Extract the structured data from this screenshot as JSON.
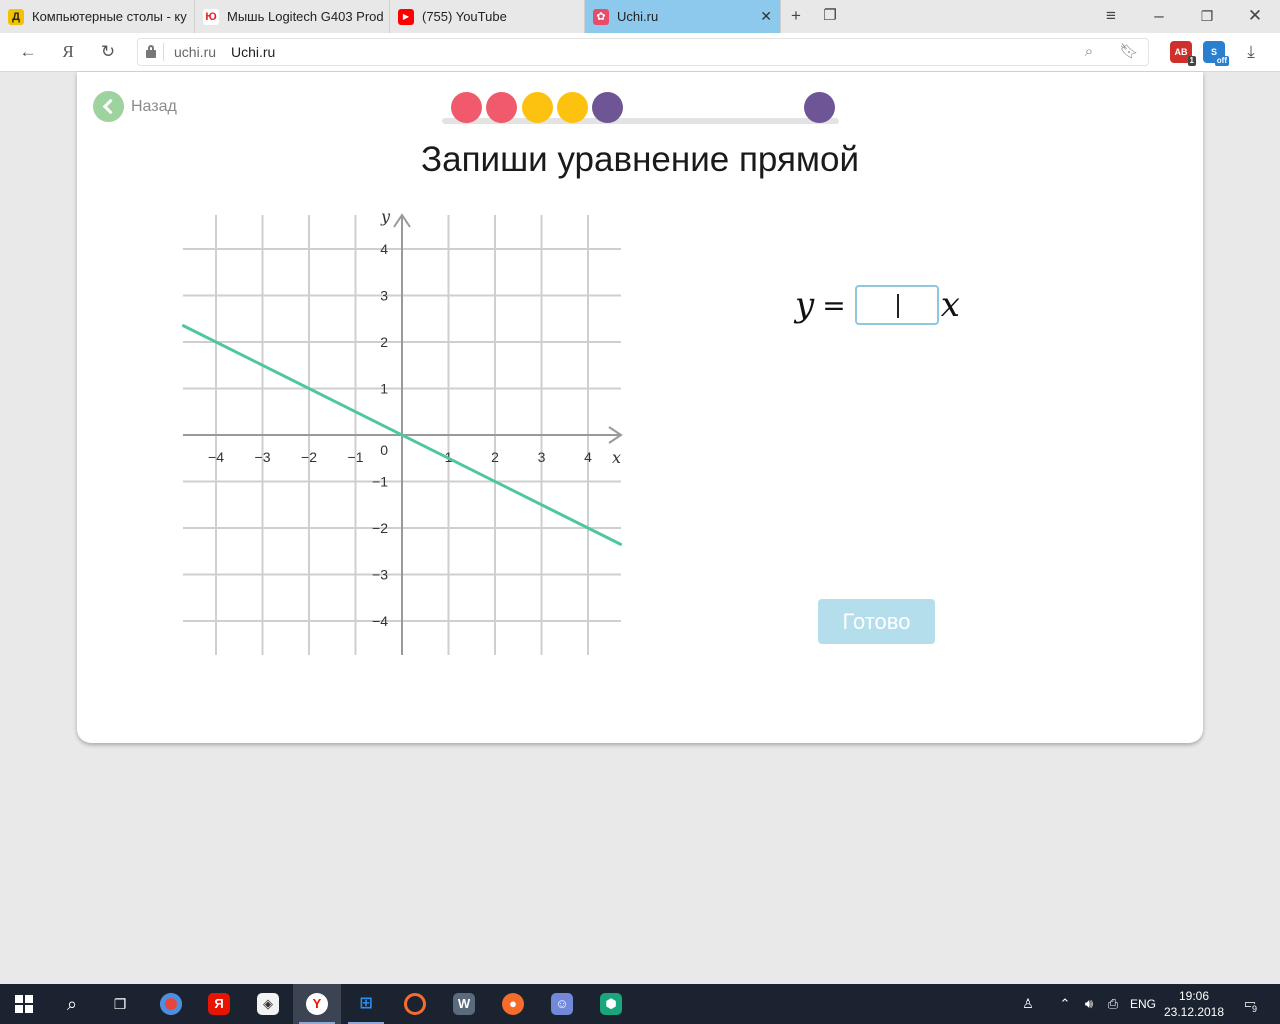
{
  "browser": {
    "tabs": [
      {
        "title": "Компьютерные столы - ку",
        "icon": "dns-icon",
        "color": "#f2c200",
        "glyph": "Д"
      },
      {
        "title": "Мышь Logitech G403 Prod",
        "icon": "yulmart-icon",
        "color": "#e31e24",
        "glyph": "Ю"
      },
      {
        "title": "(755) YouTube",
        "icon": "youtube-icon",
        "color": "#ff0000",
        "glyph": "▶"
      },
      {
        "title": "Uchi.ru",
        "icon": "uchi-icon",
        "color": "#e84c6a",
        "glyph": "✿",
        "active": true
      }
    ],
    "address": {
      "domain": "uchi.ru",
      "title": "Uchi.ru"
    },
    "extensions": [
      {
        "label": "AB",
        "color": "#d0302b",
        "badge": "1"
      },
      {
        "label": "S",
        "color": "#2a7fcf",
        "badge": "off"
      }
    ]
  },
  "page": {
    "back_label": "Назад",
    "progress": {
      "dots": [
        "#f05a6c",
        "#f05a6c",
        "#fcc20f",
        "#fcc20f",
        "#6e5696",
        "",
        "",
        "",
        "",
        "",
        "#6e5696"
      ]
    },
    "title": "Запиши уравнение прямой",
    "equation": {
      "lhs": "y",
      "equals": "=",
      "input_value": "",
      "rhs": "x"
    },
    "done_label": "Готово"
  },
  "chart_data": {
    "type": "line",
    "xlabel": "x",
    "ylabel": "y",
    "xlim": [
      -4.7,
      4.7
    ],
    "ylim": [
      -4.7,
      4.7
    ],
    "grid": true,
    "origin_label": "0",
    "x_ticks": [
      -4,
      -3,
      -2,
      -1,
      1,
      2,
      3,
      4
    ],
    "y_ticks": [
      4,
      3,
      2,
      1,
      -1,
      -2,
      -3,
      -4
    ],
    "x_tick_labels": [
      "−4",
      "−3",
      "−2",
      "−1",
      "1",
      "2",
      "3",
      "4"
    ],
    "y_tick_labels": [
      "4",
      "3",
      "2",
      "1",
      "−1",
      "−2",
      "−3",
      "−4"
    ],
    "series": [
      {
        "x": [
          -4.7,
          4.7
        ],
        "y": [
          2.35,
          -2.35
        ],
        "color": "#4fc79e"
      }
    ]
  },
  "taskbar": {
    "language": "ENG",
    "time": "19:06",
    "date": "23.12.2018",
    "notifications": "9"
  }
}
